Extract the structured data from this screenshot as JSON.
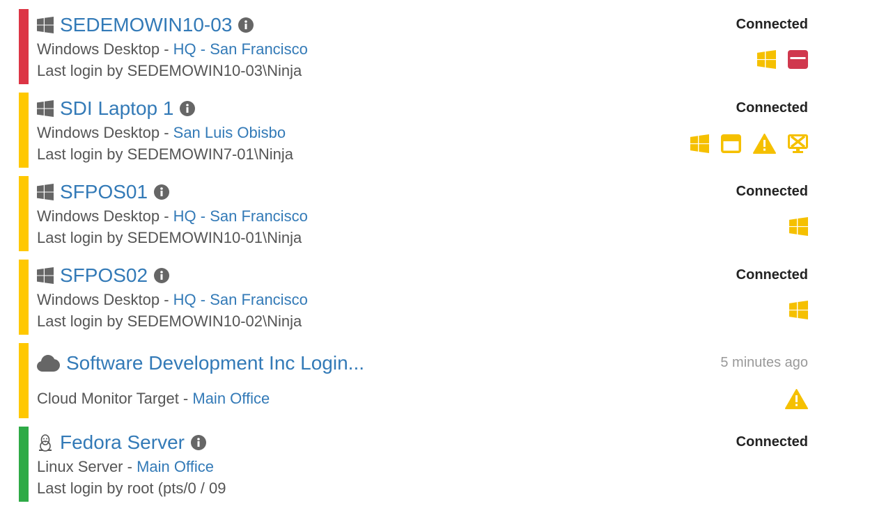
{
  "colors": {
    "critical": "#dc3545",
    "warning": "#ffc800",
    "ok": "#2eaa46",
    "link": "#337ab7",
    "icon_yellow": "#f5c000",
    "icon_red": "#d0384e"
  },
  "devices": [
    {
      "name": "SEDEMOWIN10-03",
      "os_icon": "windows-icon",
      "status_color": "critical",
      "type": "Windows Desktop",
      "separator": " - ",
      "location": "HQ - San Francisco",
      "last_login": "Last login by SEDEMOWIN10-03\\Ninja",
      "status": "Connected",
      "alert_icons": [
        "windows-update-icon",
        "window-alert-icon"
      ]
    },
    {
      "name": "SDI Laptop 1",
      "os_icon": "windows-icon",
      "status_color": "warning",
      "type": "Windows Desktop",
      "separator": " - ",
      "location": "San Luis Obisbo",
      "last_login": "Last login by SEDEMOWIN7-01\\Ninja",
      "status": "Connected",
      "alert_icons": [
        "windows-update-icon",
        "window-alert-icon",
        "warning-icon",
        "monitor-disconnected-icon"
      ]
    },
    {
      "name": "SFPOS01",
      "os_icon": "windows-icon",
      "status_color": "warning",
      "type": "Windows Desktop",
      "separator": " - ",
      "location": "HQ - San Francisco",
      "last_login": "Last login by SEDEMOWIN10-01\\Ninja",
      "status": "Connected",
      "alert_icons": [
        "windows-update-icon"
      ]
    },
    {
      "name": "SFPOS02",
      "os_icon": "windows-icon",
      "status_color": "warning",
      "type": "Windows Desktop",
      "separator": " - ",
      "location": "HQ - San Francisco",
      "last_login": "Last login by SEDEMOWIN10-02\\Ninja",
      "status": "Connected",
      "alert_icons": [
        "windows-update-icon"
      ]
    },
    {
      "name": "Software Development Inc Login...",
      "os_icon": "cloud-icon",
      "status_color": "warning",
      "type": "Cloud Monitor Target",
      "separator": " - ",
      "location": "Main Office",
      "last_login": "",
      "status": "5 minutes ago",
      "alert_icons": [
        "warning-icon"
      ]
    },
    {
      "name": "Fedora Server",
      "os_icon": "linux-icon",
      "status_color": "ok",
      "type": "Linux Server",
      "separator": " - ",
      "location": "Main Office",
      "last_login": "Last login by root (pts/0 / 09",
      "status": "Connected",
      "alert_icons": []
    }
  ]
}
